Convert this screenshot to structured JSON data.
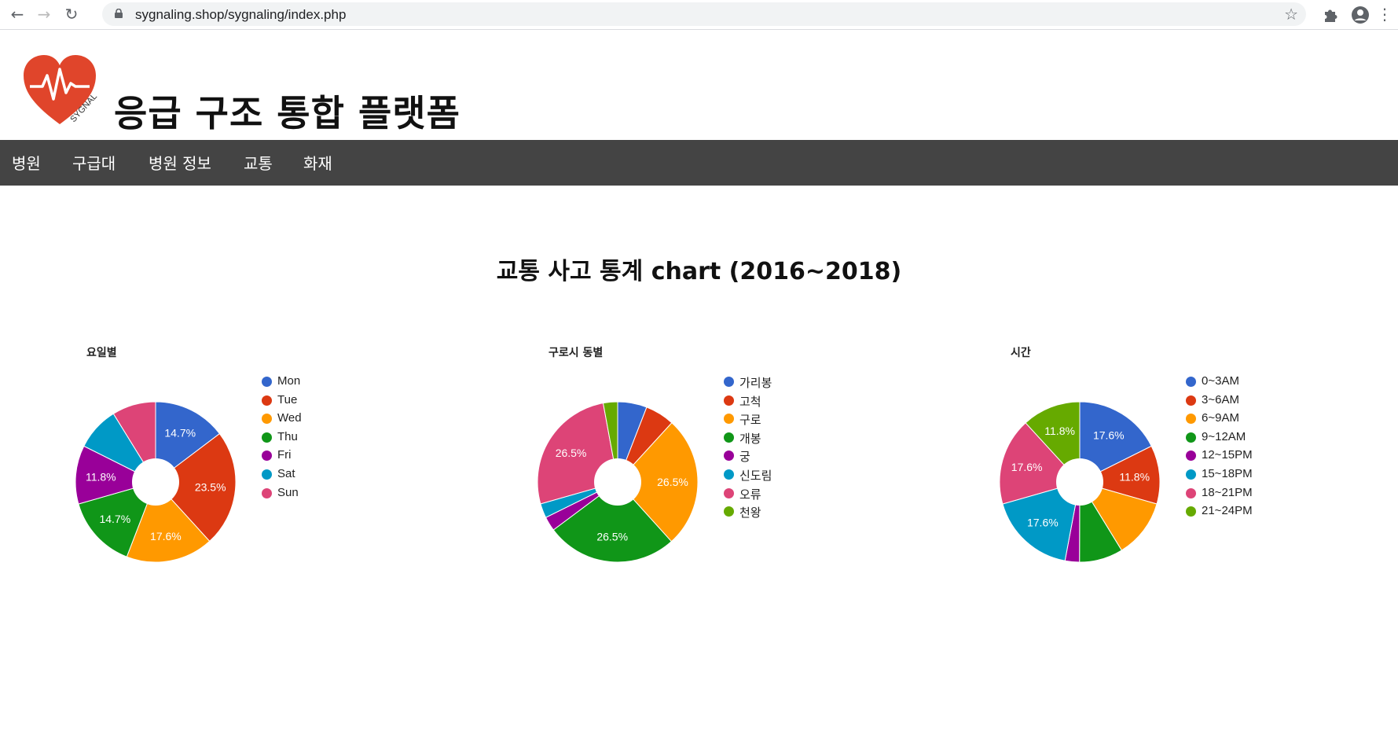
{
  "browser": {
    "url": "sygnaling.shop/sygnaling/index.php"
  },
  "header": {
    "logo_text": "SYGNAL",
    "title": "응급 구조 통합 플랫폼"
  },
  "nav": {
    "items": [
      {
        "label": "병원"
      },
      {
        "label": "구급대"
      },
      {
        "label": "병원 정보"
      },
      {
        "label": "교통"
      },
      {
        "label": "화재"
      }
    ]
  },
  "page": {
    "title": "교통 사고 통계 chart (2016~2018)"
  },
  "colors": {
    "navbar": "#444444",
    "brand_red": "#e0452b",
    "palette": [
      "#3366cc",
      "#dc3912",
      "#ff9900",
      "#109618",
      "#990099",
      "#0099c6",
      "#dd4477",
      "#66aa00"
    ]
  },
  "chart_data": [
    {
      "type": "pie",
      "title": "요일별",
      "donut": true,
      "categories": [
        "Mon",
        "Tue",
        "Wed",
        "Thu",
        "Fri",
        "Sat",
        "Sun"
      ],
      "values": [
        14.7,
        23.5,
        17.6,
        14.7,
        11.8,
        8.8,
        8.8
      ],
      "data_labels": [
        "14.7%",
        "23.5%",
        "17.6%",
        "14.7%",
        "11.8%",
        "",
        ""
      ],
      "legend": "right"
    },
    {
      "type": "pie",
      "title": "구로시 동별",
      "donut": true,
      "categories": [
        "가리봉",
        "고척",
        "구로",
        "개봉",
        "궁",
        "신도림",
        "오류",
        "천왕"
      ],
      "values": [
        5.9,
        5.9,
        26.5,
        26.5,
        2.9,
        2.9,
        26.5,
        2.9
      ],
      "data_labels": [
        "",
        "",
        "26.5%",
        "26.5%",
        "",
        "",
        "26.5%",
        ""
      ],
      "legend": "right"
    },
    {
      "type": "pie",
      "title": "시간",
      "donut": true,
      "categories": [
        "0~3AM",
        "3~6AM",
        "6~9AM",
        "9~12AM",
        "12~15PM",
        "15~18PM",
        "18~21PM",
        "21~24PM"
      ],
      "values": [
        17.6,
        11.8,
        11.8,
        8.8,
        2.9,
        17.6,
        17.6,
        11.8
      ],
      "data_labels": [
        "17.6%",
        "11.8%",
        "",
        "",
        "",
        "17.6%",
        "17.6%",
        "11.8%"
      ],
      "legend": "right"
    }
  ]
}
